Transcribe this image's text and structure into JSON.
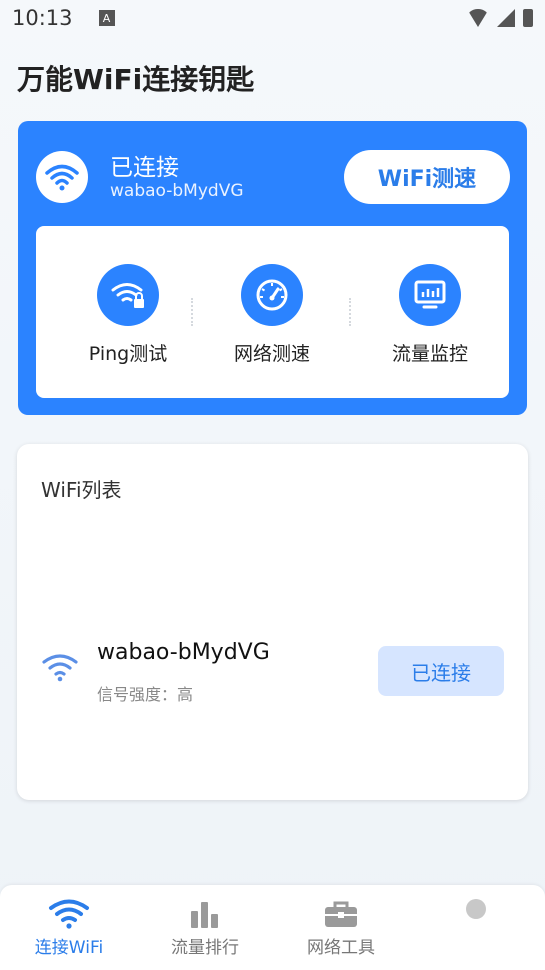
{
  "status_bar": {
    "time": "10:13",
    "notification": "A"
  },
  "app": {
    "title": "万能WiFi连接钥匙"
  },
  "connection": {
    "status": "已连接",
    "ssid": "wabao-bMydVG",
    "speed_test_label": "WiFi测速"
  },
  "tools": [
    {
      "label": "Ping测试",
      "icon": "wifi-lock-icon"
    },
    {
      "label": "网络测速",
      "icon": "speedometer-icon"
    },
    {
      "label": "流量监控",
      "icon": "monitor-chart-icon"
    }
  ],
  "wifi_list": {
    "title": "WiFi列表",
    "networks": [
      {
        "ssid": "wabao-bMydVG",
        "signal": "信号强度：高",
        "action": "已连接"
      }
    ]
  },
  "bottom_nav": [
    {
      "label": "连接WiFi",
      "icon": "wifi-icon",
      "active": true
    },
    {
      "label": "流量排行",
      "icon": "bar-chart-icon",
      "active": false
    },
    {
      "label": "网络工具",
      "icon": "toolbox-icon",
      "active": false
    },
    {
      "label": "",
      "icon": "dot-icon",
      "active": false
    }
  ],
  "colors": {
    "primary": "#2b83ff",
    "accent_text": "#2b7de9",
    "pill_bg": "#d6e5ff"
  }
}
